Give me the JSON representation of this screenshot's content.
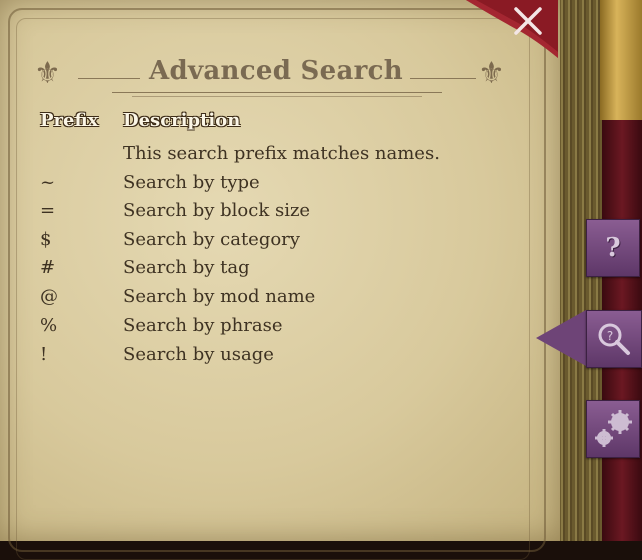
{
  "dialog": {
    "title": "Advanced Search"
  },
  "table": {
    "headers": {
      "prefix": "Prefix",
      "description": "Description"
    },
    "rows": [
      {
        "prefix": "",
        "description": "This search prefix matches names."
      },
      {
        "prefix": "~",
        "description": "Search by type"
      },
      {
        "prefix": "=",
        "description": "Search by block size"
      },
      {
        "prefix": "$",
        "description": "Search by category"
      },
      {
        "prefix": "#",
        "description": "Search by tag"
      },
      {
        "prefix": "@",
        "description": "Search by mod name"
      },
      {
        "prefix": "%",
        "description": "Search by phrase"
      },
      {
        "prefix": "!",
        "description": "Search by usage"
      }
    ]
  },
  "tabs": [
    {
      "icon": "question-mark-icon",
      "label": "?"
    },
    {
      "icon": "magnifier-icon",
      "active": true
    },
    {
      "icon": "gears-icon"
    }
  ],
  "icons": {
    "close": "close-icon",
    "ornament": "fleur-de-lis-icon"
  },
  "colors": {
    "parchment": "#d8c99c",
    "tab_purple": "#6e4477",
    "close_red": "#8a1a24",
    "text": "#3e3222"
  }
}
